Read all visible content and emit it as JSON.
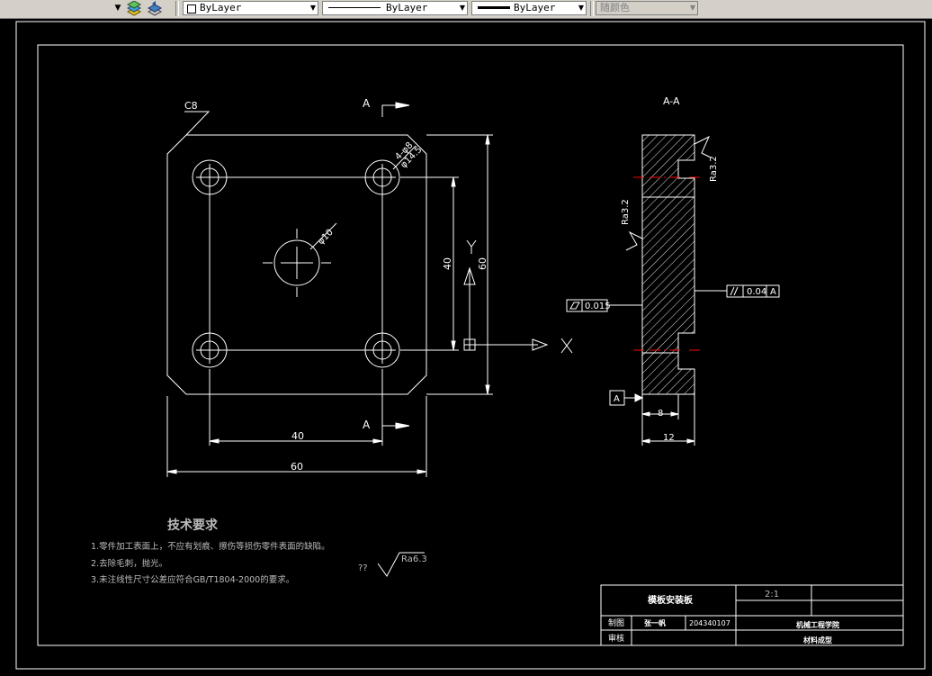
{
  "toolbar": {
    "layer_tools": [
      "layer-properties-icon",
      "layer-previous-icon"
    ],
    "color_combo": "ByLayer",
    "linetype_combo": "ByLayer",
    "lineweight_combo": "ByLayer",
    "plotstyle_combo": "随颜色"
  },
  "drawing": {
    "chamfer_label": "C8",
    "section_marker": "A",
    "hole_corner_label": "4-φ8",
    "hole_corner_label2": "φ14.5",
    "center_hole_label": "φ10",
    "dim_40_h": "40",
    "dim_60_h": "60",
    "dim_40_v": "40",
    "dim_60_v": "60",
    "axis_y": "Y",
    "axis_x": "X",
    "section_title": "A-A",
    "roughness_right": "Ra3.2",
    "roughness_left": "Ra3.2",
    "flatness_value": "0.015",
    "parallel_value": "0.04",
    "parallel_datum": "A",
    "datum_label": "A",
    "dim_8": "8",
    "dim_12": "12",
    "tech_title": "技术要求",
    "tech_notes": [
      "1.零件加工表面上，不应有划痕、擦伤等损伤零件表面的缺陷。",
      "2.去除毛刺，抛光。",
      "3.未注线性尺寸公差应符合GB/T1804-2000的要求。"
    ],
    "default_roughness_prefix": "??",
    "default_roughness": "Ra6.3"
  },
  "title_block": {
    "part_name": "模板安装板",
    "scale": "2:1",
    "drawn_label": "制图",
    "drawn_name": "张一帆",
    "drawing_no": "204340107",
    "school": "机械工程学院",
    "review_label": "审核",
    "major": "材料成型"
  },
  "colors": {
    "line": "#ffffff",
    "center_line": "#ff0000",
    "note_text": "#bbbbbb",
    "background": "#000000"
  }
}
